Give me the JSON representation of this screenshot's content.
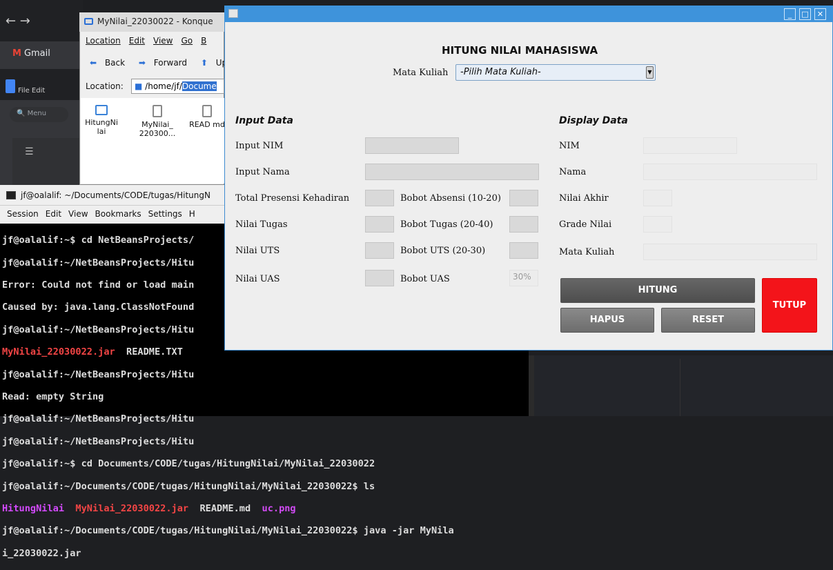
{
  "browser": {
    "gmail": "Gmail",
    "docs_menu_file": "File",
    "docs_menu_edit": "Edit",
    "search": "Menu"
  },
  "konqueror": {
    "title": "MyNilai_22030022 - Konque",
    "menu": [
      "Location",
      "Edit",
      "View",
      "Go",
      "B"
    ],
    "toolbar": {
      "back": "Back",
      "forward": "Forward",
      "up": "Up"
    },
    "location_label": "Location:",
    "location_path": "/home/jf/",
    "location_selected": "Docume",
    "files": [
      {
        "name": "HitungNi lai",
        "icon": "folder-icon"
      },
      {
        "name": "MyNilai_ 220300...",
        "icon": "jar-icon"
      },
      {
        "name": "READ md",
        "icon": "text-file-icon"
      }
    ]
  },
  "konsole": {
    "title": "jf@oalalif: ~/Documents/CODE/tugas/HitungN",
    "menu": [
      "Session",
      "Edit",
      "View",
      "Bookmarks",
      "Settings",
      "H"
    ],
    "lines": [
      {
        "text": "jf@oalalif:~$ cd NetBeansProjects/",
        "color": "#dddddd"
      },
      {
        "text": "jf@oalalif:~/NetBeansProjects/Hitu",
        "color": "#dddddd"
      },
      {
        "text": "Error: Could not find or load main",
        "color": "#dddddd"
      },
      {
        "text": "Caused by: java.lang.ClassNotFound",
        "color": "#dddddd"
      },
      {
        "text": "jf@oalalif:~/NetBeansProjects/Hitu",
        "color": "#dddddd"
      },
      {
        "text": "MyNilai_22030022.jar  README.TXT",
        "color": "mixed1"
      },
      {
        "text": "jf@oalalif:~/NetBeansProjects/Hitu",
        "color": "#dddddd"
      },
      {
        "text": "Read: empty String",
        "color": "#dddddd"
      },
      {
        "text": "jf@oalalif:~/NetBeansProjects/Hitu",
        "color": "#dddddd"
      },
      {
        "text": "jf@oalalif:~/NetBeansProjects/Hitu",
        "color": "#dddddd"
      },
      {
        "text": "jf@oalalif:~$ cd Documents/CODE/tugas/HitungNilai/MyNilai_22030022",
        "color": "#dddddd"
      },
      {
        "text": "jf@oalalif:~/Documents/CODE/tugas/HitungNilai/MyNilai_22030022$ ls",
        "color": "#dddddd"
      },
      {
        "text": "HitungNilai  MyNilai_22030022.jar  README.md  uc.png",
        "color": "mixed2"
      },
      {
        "text": "jf@oalalif:~/Documents/CODE/tugas/HitungNilai/MyNilai_22030022$ java -jar MyNila",
        "color": "#dddddd"
      },
      {
        "text": "i_22030022.jar",
        "color": "#dddddd"
      }
    ],
    "ls1": {
      "jar": "MyNilai_22030022.jar",
      "rest": "  README.TXT"
    },
    "ls2": {
      "dir": "HitungNilai",
      "jar": "MyNilai_22030022.jar",
      "md": "README.md",
      "png": "uc.png"
    }
  },
  "app": {
    "heading": "HITUNG NILAI MAHASISWA",
    "matakuliah_label": "Mata Kuliah",
    "matakuliah_value": "-Pilih Mata Kuliah-",
    "input_section": "Input Data",
    "display_section": "Display Data",
    "labels": {
      "nim": "Input NIM",
      "nama": "Input Nama",
      "presensi": "Total Presensi Kehadiran",
      "tugas": "Nilai Tugas",
      "uts": "Nilai UTS",
      "uas": "Nilai UAS",
      "bobot_absensi": "Bobot Absensi (10-20)",
      "bobot_tugas": "Bobot Tugas (20-40)",
      "bobot_uts": "Bobot UTS (20-30)",
      "bobot_uas": "Bobot UAS"
    },
    "bobot_uas_value": "30%",
    "display_labels": {
      "nim": "NIM",
      "nama": "Nama",
      "nilai_akhir": "Nilai Akhir",
      "grade": "Grade Nilai",
      "matkul": "Mata Kuliah"
    },
    "buttons": {
      "hitung": "HITUNG",
      "hapus": "HAPUS",
      "reset": "RESET",
      "tutup": "TUTUP"
    },
    "colors": {
      "titlebar": "#3e93db",
      "tutup": "#f3141a"
    }
  }
}
